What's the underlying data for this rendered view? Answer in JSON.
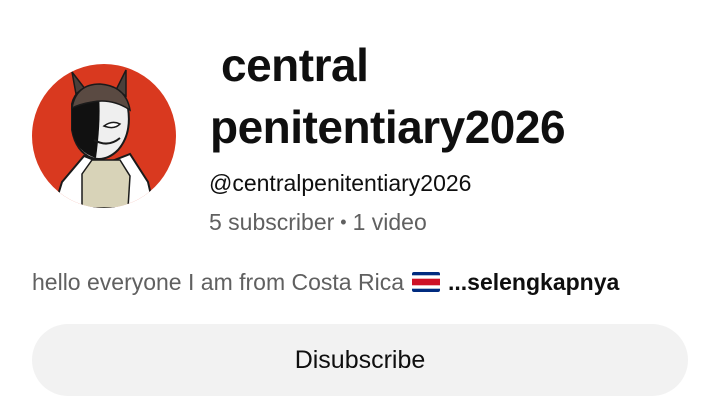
{
  "channel": {
    "name_line1": "central",
    "name_line2": "penitentiary2026",
    "handle": "@centralpenitentiary2026",
    "subscribers": "5 subscriber",
    "separator": "•",
    "videos": "1 video",
    "description": "hello everyone I am from Costa Rica",
    "flag_icon": "costa-rica-flag-icon",
    "more_label": "...selengkapnya"
  },
  "actions": {
    "subscribe_label": "Disubscribe"
  },
  "colors": {
    "avatar_background": "#d9391f",
    "button_background": "#f2f2f2",
    "secondary_text": "#606060"
  }
}
